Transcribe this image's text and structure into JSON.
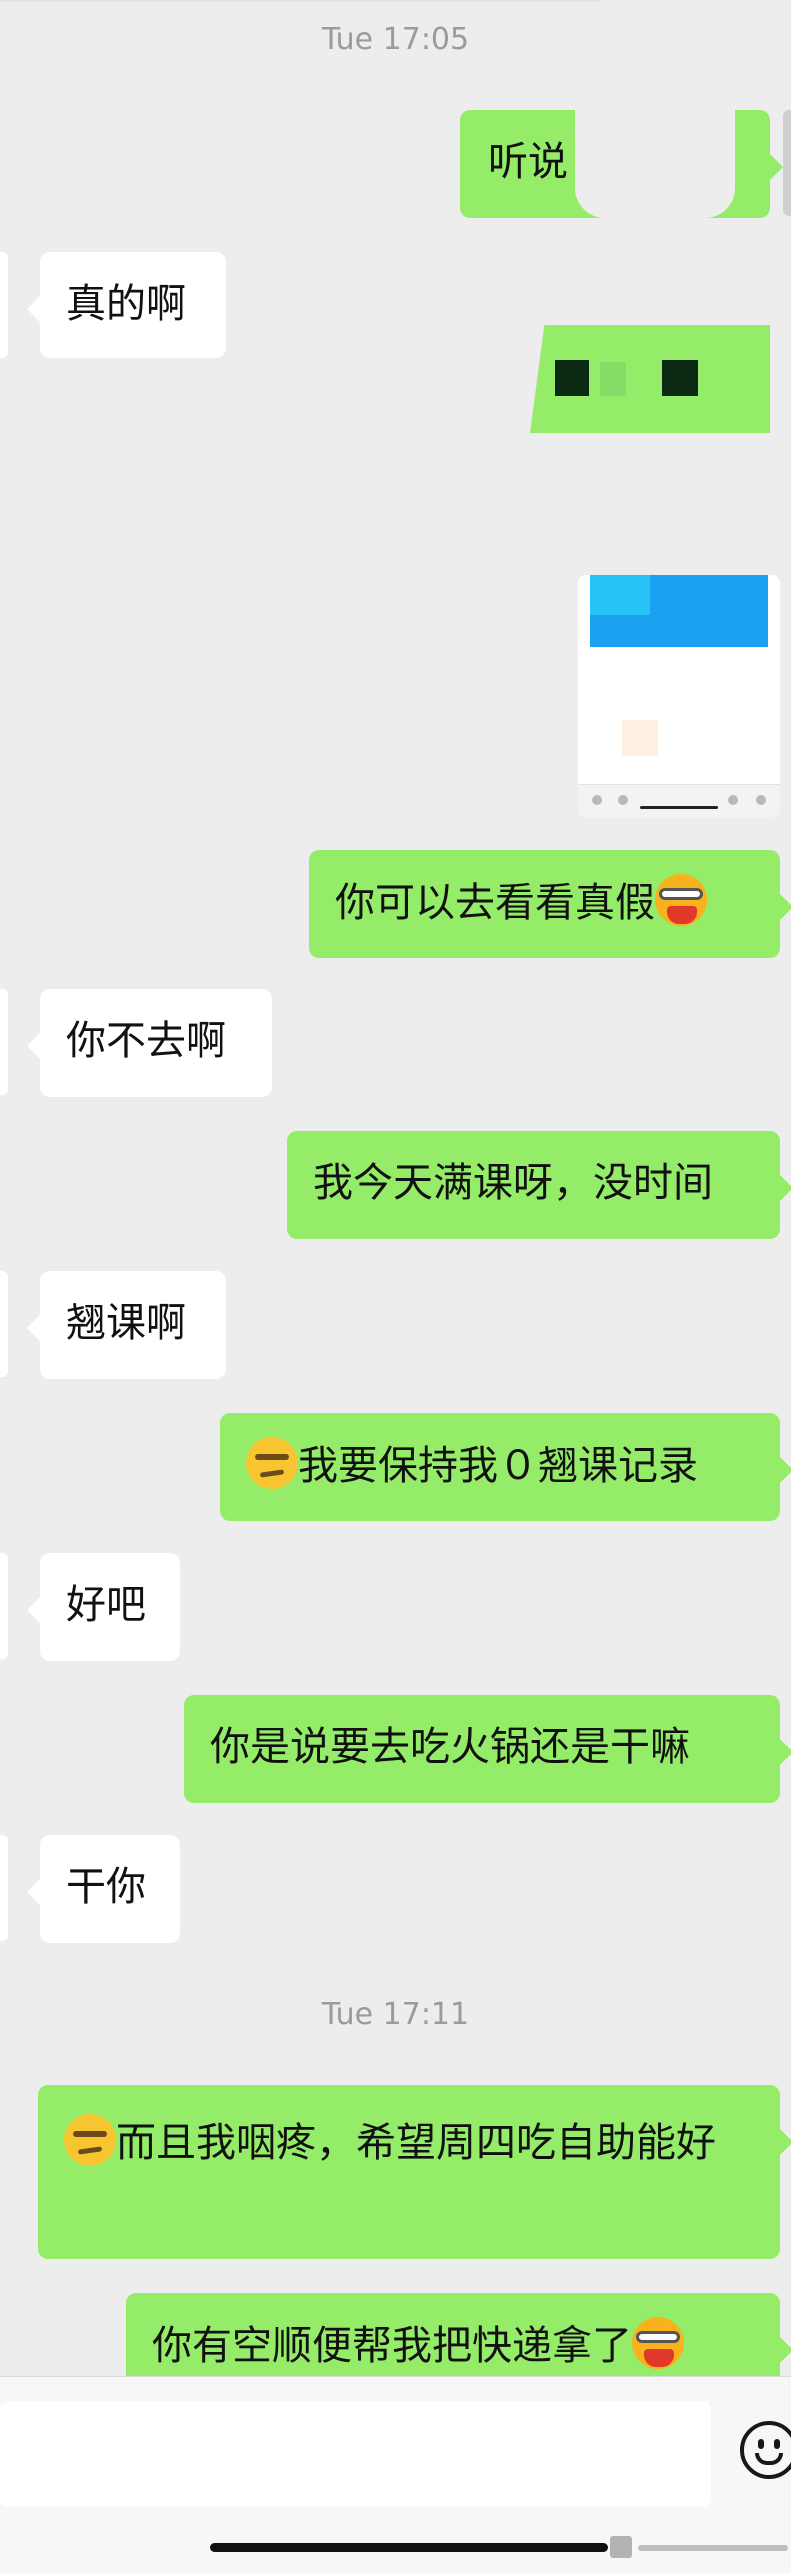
{
  "timestamps": [
    "Tue 17:05",
    "Tue 17:11"
  ],
  "messages": {
    "m1": "听说",
    "m2": "真的啊",
    "m4": "你可以去看看真假",
    "m5": "你不去啊",
    "m6": "我今天满课呀，没时间",
    "m7": "翘课啊",
    "m8": "我要保持我０翘课记录",
    "m9": "好吧",
    "m10": "你是说要去吃火锅还是干嘛",
    "m11": "干你",
    "m12": "而且我咽疼，希望周四吃自助能好",
    "m13": "你有空顺便帮我把快递拿了"
  },
  "icons": {
    "smirk_emoji": "smirk-emoji",
    "bowl_emoji": "noodle-bowl-emoji",
    "emoji_button": "smiley-face-icon"
  },
  "colors": {
    "outgoing_bubble": "#95ec69",
    "incoming_bubble": "#ffffff",
    "background": "#ededed",
    "timestamp": "#9b9b9b"
  }
}
